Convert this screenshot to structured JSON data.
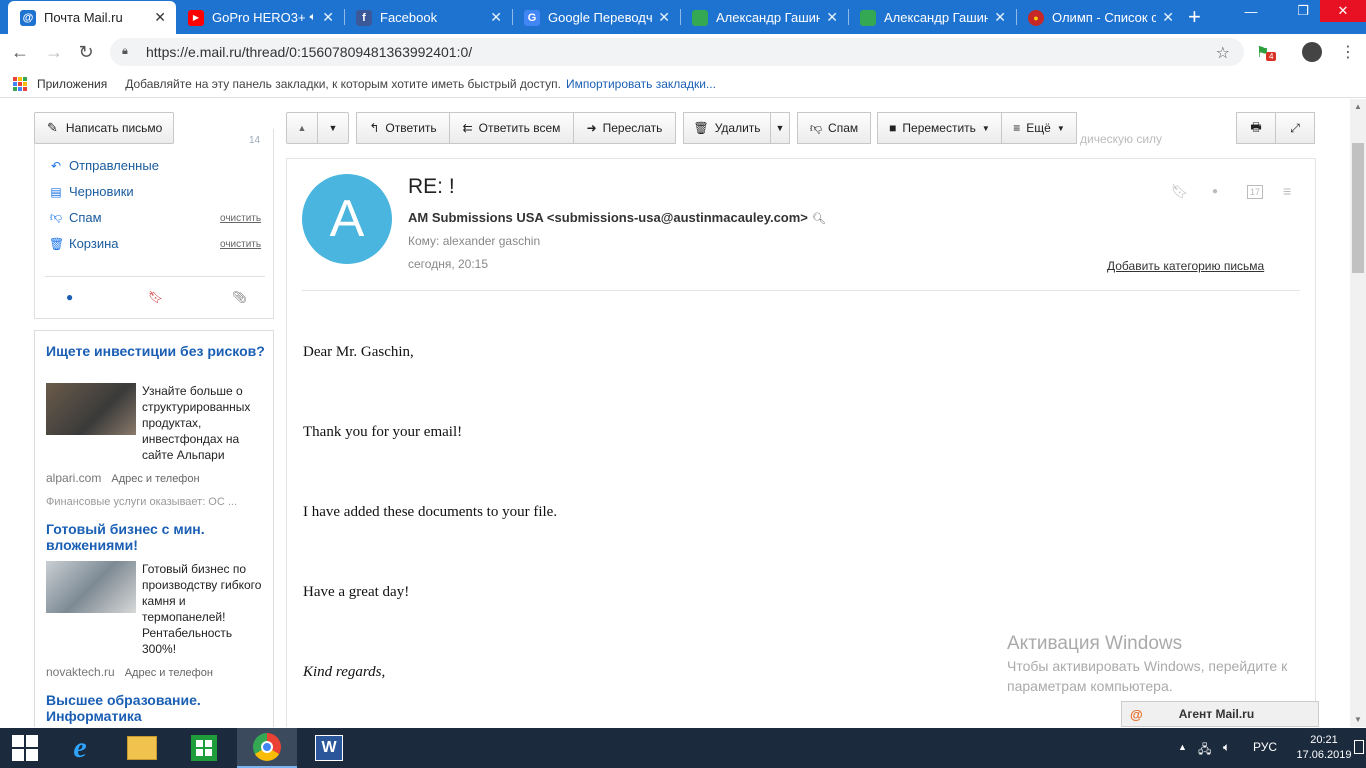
{
  "browser": {
    "tabs": [
      {
        "title": "Почта Mail.ru",
        "close": "✕",
        "active": true
      },
      {
        "title": "GoPro HERO3+",
        "close": "✕",
        "active": false
      },
      {
        "title": "Facebook",
        "close": "✕",
        "active": false
      },
      {
        "title": "Google Переводчик",
        "close": "✕",
        "active": false
      },
      {
        "title": "Александр Гашин",
        "close": "✕",
        "active": false
      },
      {
        "title": "Александр Гашин",
        "close": "✕",
        "active": false
      },
      {
        "title": "Олимп - Список см",
        "close": "✕",
        "active": false
      }
    ],
    "new_tab": "+",
    "url": "https://e.mail.ru/thread/0:15607809481363992401:0/",
    "extension_badge": "4",
    "bookmarks": {
      "apps_label": "Приложения",
      "hint": "Добавляйте на эту панель закладки, к которым хотите иметь быстрый доступ.",
      "import_link": "Импортировать закладки..."
    }
  },
  "sidebar": {
    "compose_label": "Написать письмо",
    "inbox_count": "14",
    "folders": [
      {
        "label": "Отправленные",
        "icon": "sent-icon"
      },
      {
        "label": "Черновики",
        "icon": "drafts-icon"
      },
      {
        "label": "Спам",
        "icon": "spam-icon",
        "action": "очистить"
      },
      {
        "label": "Корзина",
        "icon": "trash-icon",
        "action": "очистить"
      }
    ]
  },
  "ads": [
    {
      "title": "Ищете инвестиции без рисков?",
      "text": "Узнайте больше о структурированных продуктах, инвестфондах на сайте Альпари",
      "domain": "alpari.com",
      "address": "Адрес и телефон",
      "note": "Финансовые услуги оказывает: ОС ..."
    },
    {
      "title": "Готовый бизнес с мин. вложениями!",
      "text": "Готовый бизнес по производству гибкого камня и термопанелей! Рентабельность 300%!",
      "domain": "novaktech.ru",
      "address": "Адрес и телефон"
    },
    {
      "title": "Высшее образование. Информатика"
    }
  ],
  "toolbar": {
    "reply": "Ответить",
    "reply_all": "Ответить всем",
    "forward": "Переслать",
    "delete": "Удалить",
    "spam": "Спам",
    "move": "Переместить",
    "more": "Ещё",
    "faint_text": "дическую силу"
  },
  "message": {
    "avatar_letter": "A",
    "subject": "RE: !",
    "from": "AM Submissions USA <submissions-usa@austinmacauley.com>",
    "to": "Кому: alexander gaschin",
    "date": "сегодня, 20:15",
    "add_category": "Добавить категорию письма",
    "calendar_day": "17",
    "body": [
      "Dear Mr. Gaschin,",
      "Thank you for your email!",
      "I have added these documents to your file.",
      "Have a great day!",
      "Kind regards,"
    ]
  },
  "watermark": {
    "title": "Активация Windows",
    "text": "Чтобы активировать Windows, перейдите к параметрам компьютера."
  },
  "agent": {
    "label": "Агент Mail.ru"
  },
  "taskbar": {
    "lang": "РУС",
    "time": "20:21",
    "date": "17.06.2019"
  }
}
